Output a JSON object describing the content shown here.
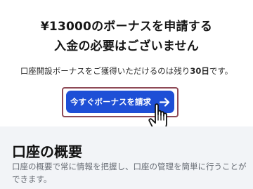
{
  "promo": {
    "headline_line1": "¥13000のボーナスを申請する",
    "headline_line2": "入金の必要はございません",
    "note_prefix": "口座開設ボーナスをご獲得いただけるのは残り",
    "note_days": "30日",
    "note_suffix": "です。",
    "cta_label": "今すぐボーナスを請求",
    "cta_color": "#1e4fd6"
  },
  "overview": {
    "title": "口座の概要",
    "description": "口座の概要で常に情報を把握し、口座の管理を簡単に行うことができます。"
  },
  "icons": {
    "cta_arrow": "arrow-right-icon",
    "cursor": "hand-pointer-icon"
  }
}
